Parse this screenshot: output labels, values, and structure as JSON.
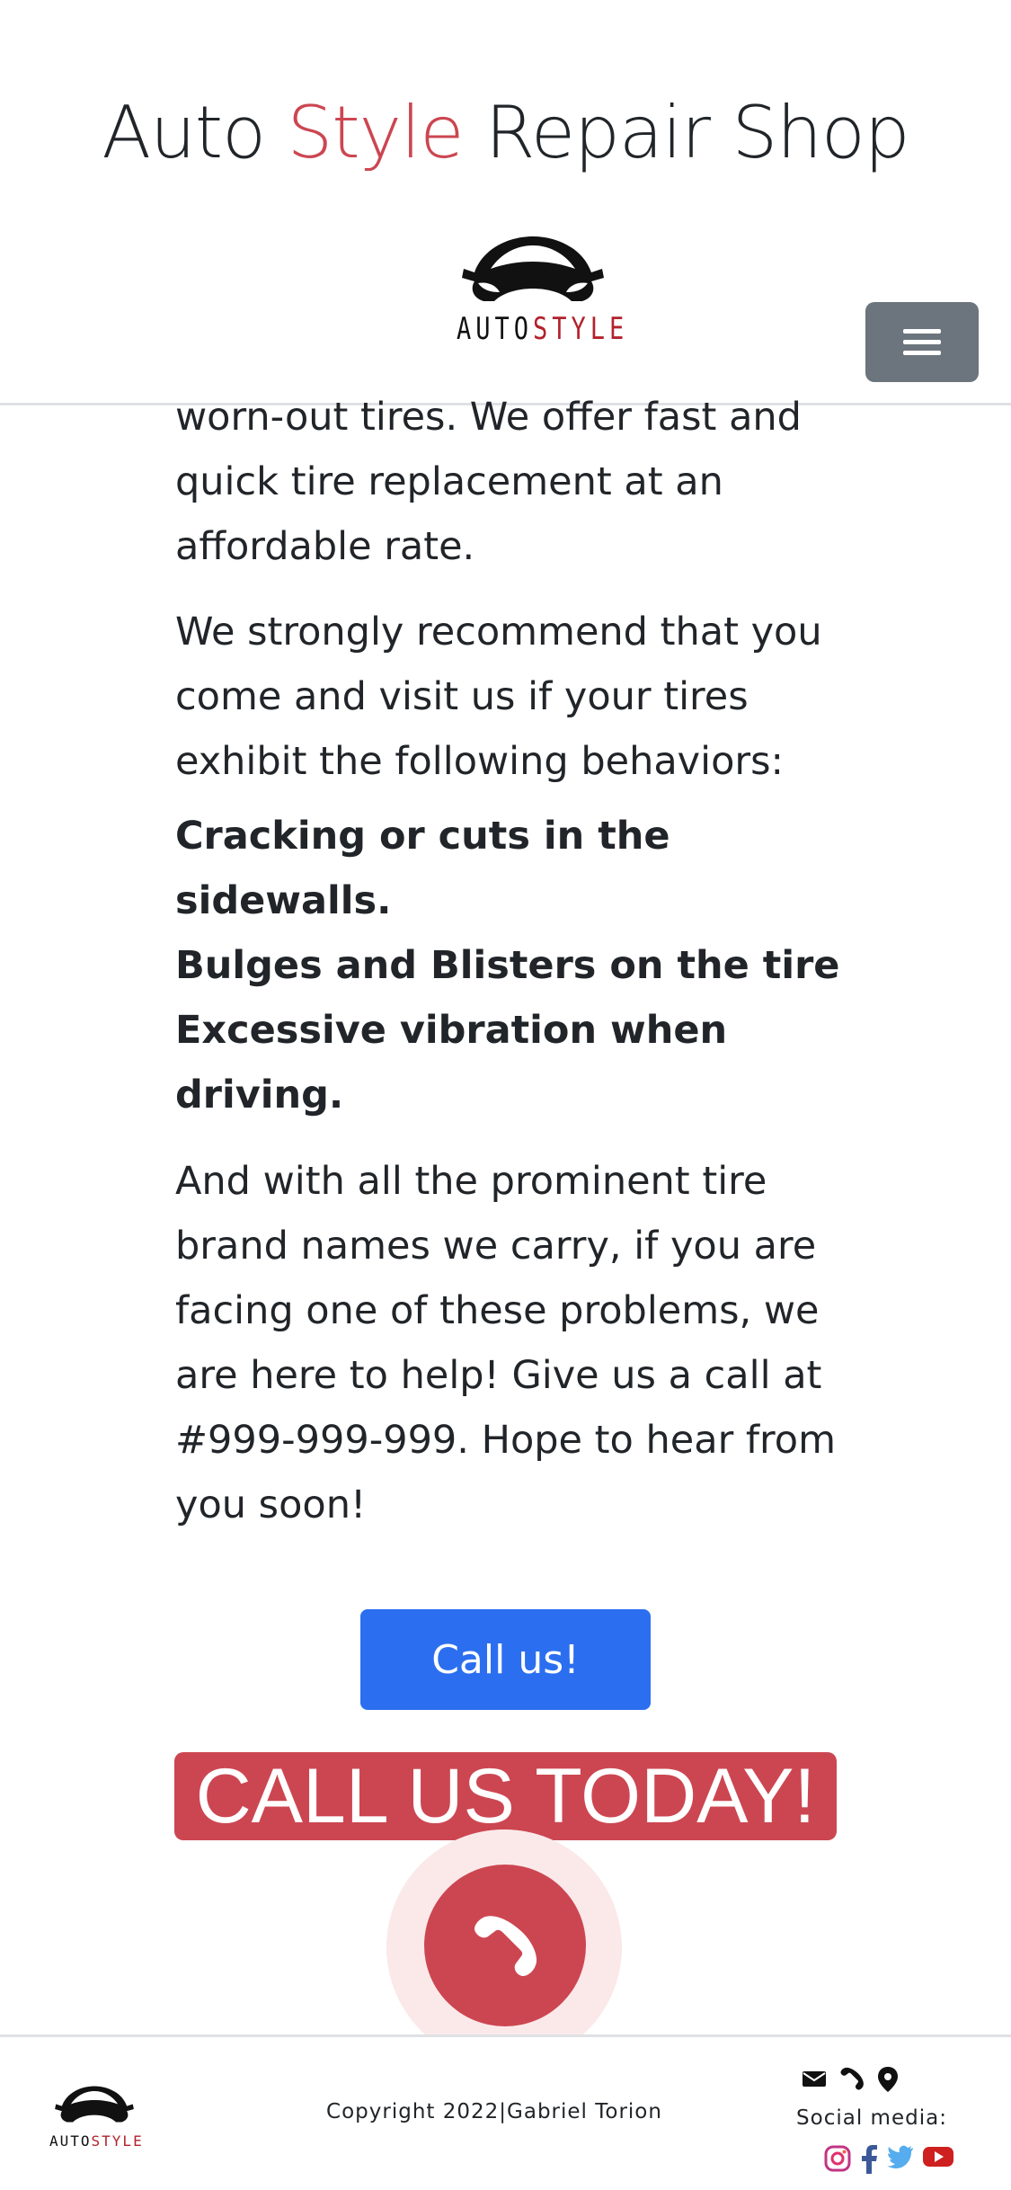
{
  "header": {
    "title_part1": "Auto ",
    "title_accent": "Style",
    "title_part2": " Repair Shop",
    "logo_text_a": "AUTO",
    "logo_text_b": "STYLE",
    "menu_icon": "hamburger-icon"
  },
  "content": {
    "para1": "worn-out tires. We offer fast and quick tire replacement at an affordable rate.",
    "para2": "We strongly recommend that you come and visit us if your tires exhibit the following behaviors:",
    "symptoms": [
      "Cracking or cuts in the sidewalls.",
      "Bulges and Blisters on the tire",
      "Excessive vibration when driving."
    ],
    "para3": "And with all the prominent tire brand names we carry, if you are facing one of these problems, we are here to help! Give us a call at #999-999-999. Hope to hear from you soon!"
  },
  "call_button": {
    "label": "Call us!"
  },
  "banner": {
    "text": "CALL US TODAY!"
  },
  "phone_fab": {
    "icon": "phone-icon"
  },
  "footer": {
    "logo_text_a": "AUTO",
    "logo_text_b": "STYLE",
    "copyright": "Copyright 2022|Gabriel Torion",
    "contact_icons": [
      "mail-icon",
      "phone-icon",
      "location-pin-icon"
    ],
    "social_label": "Social media:",
    "social_icons": [
      "instagram-icon",
      "facebook-icon",
      "twitter-icon",
      "youtube-icon"
    ]
  },
  "colors": {
    "accent_red": "#cc4651",
    "primary_blue": "#2b6ff0",
    "menu_gray": "#6c757d",
    "text": "#212529"
  }
}
